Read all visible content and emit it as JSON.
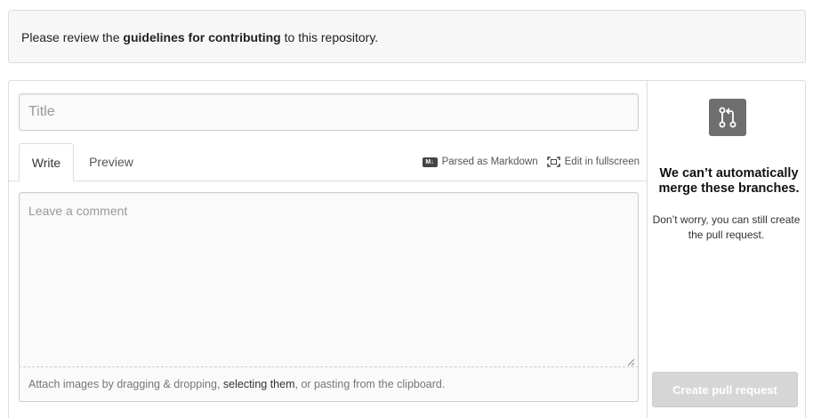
{
  "notice": {
    "text_before": "Please review the ",
    "link_text": "guidelines for contributing",
    "text_after": " to this repository."
  },
  "form": {
    "title_placeholder": "Title",
    "title_value": "",
    "tabs": [
      {
        "label": "Write",
        "active": true
      },
      {
        "label": "Preview",
        "active": false
      }
    ],
    "toolbar": {
      "markdown_icon": "M↓",
      "markdown_label": "Parsed as Markdown",
      "fullscreen_label": "Edit in fullscreen"
    },
    "comment_placeholder": "Leave a comment",
    "comment_value": "",
    "attach": {
      "text_before": "Attach images by dragging & dropping, ",
      "link_text": "selecting them",
      "text_after": ", or pasting from the clipboard."
    }
  },
  "merge_status": {
    "icon": "git-pull-request-icon",
    "heading": "We can’t automatically merge these branches.",
    "subtext": "Don’t worry, you can still create the pull request.",
    "button_label": "Create pull request",
    "button_enabled": false
  },
  "colors": {
    "border": "#dddddd",
    "notice_bg": "#f7f7f7",
    "icon_box": "#6e6e6e",
    "disabled_button": "#d6d6d6"
  }
}
